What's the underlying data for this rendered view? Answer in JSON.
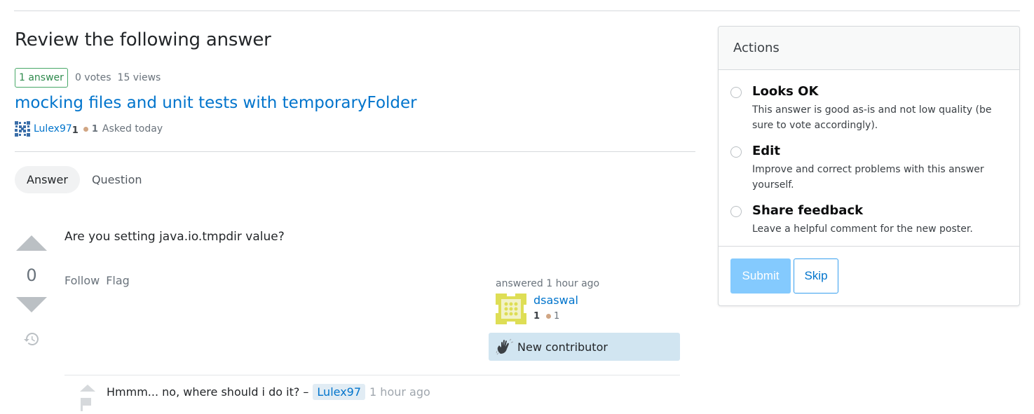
{
  "header": {
    "title": "Review the following answer"
  },
  "question": {
    "answers_badge": "1 answer",
    "votes": "0 votes",
    "views": "15 views",
    "title": "mocking files and unit tests with temporaryFolder",
    "owner": {
      "name": "Lulex97",
      "reputation": "1",
      "bronze_badges": "1",
      "asked": "Asked today"
    }
  },
  "tabs": [
    {
      "label": "Answer",
      "active": true
    },
    {
      "label": "Question",
      "active": false
    }
  ],
  "answer": {
    "score": "0",
    "body": "Are you setting java.io.tmpdir value?",
    "menu": {
      "follow": "Follow",
      "flag": "Flag"
    },
    "signature": {
      "action_time": "answered 1 hour ago",
      "user_name": "dsaswal",
      "reputation": "1",
      "bronze_badges": "1",
      "new_contributor": "New contributor"
    },
    "comments": [
      {
        "text": "Hmmm... no, where should i do it? –",
        "user": "Lulex97",
        "date": "1 hour ago"
      }
    ]
  },
  "actions_panel": {
    "title": "Actions",
    "options": [
      {
        "title": "Looks OK",
        "description": "This answer is good as-is and not low quality (be sure to vote accordingly)."
      },
      {
        "title": "Edit",
        "description": "Improve and correct problems with this answer yourself."
      },
      {
        "title": "Share feedback",
        "description": "Leave a helpful comment for the new poster."
      }
    ],
    "submit_label": "Submit",
    "skip_label": "Skip"
  },
  "colors": {
    "link": "#0074cc",
    "answer_badge": "#48a868",
    "submit_disabled": "#84cafe",
    "new_contributor_bg": "#d1e5f1",
    "bronze": "#d1a684"
  }
}
